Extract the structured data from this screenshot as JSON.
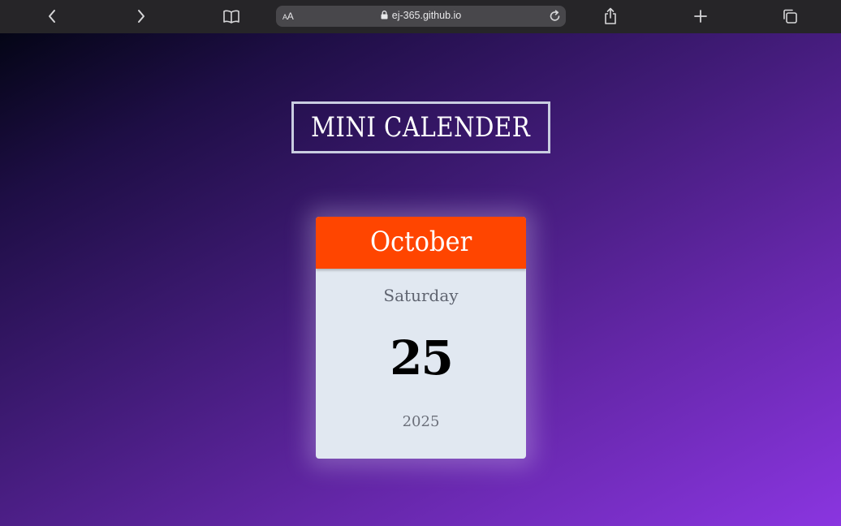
{
  "browser": {
    "aa_label_small": "A",
    "aa_label_large": "A",
    "url": "ej-365.github.io",
    "icons": [
      "back-icon",
      "forward-icon",
      "bookmarks-icon",
      "lock-icon",
      "reload-icon",
      "share-icon",
      "new-tab-icon",
      "tabs-icon"
    ]
  },
  "page": {
    "title": "MINI CALENDER"
  },
  "calendar": {
    "month": "October",
    "weekday": "Saturday",
    "day": "25",
    "year": "2025",
    "colors": {
      "header": "#ff4500",
      "card": "#e1e8f1"
    }
  }
}
